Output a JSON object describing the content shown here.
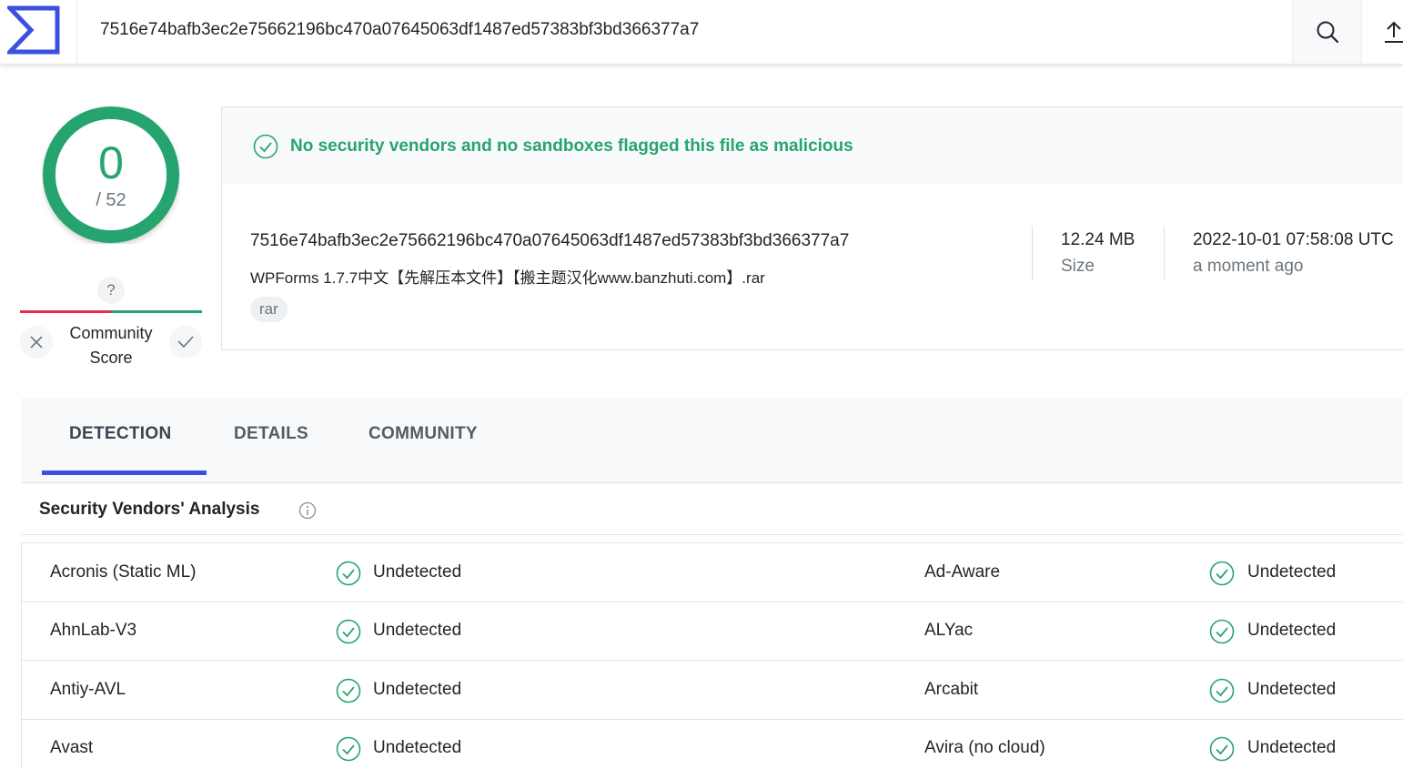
{
  "header": {
    "search_value": "7516e74bafb3ec2e75662196bc470a07645063df1487ed57383bf3bd366377a7",
    "logo_icon": "virustotal-sigma-logo-icon",
    "search_icon": "search-icon",
    "upload_icon": "upload-icon"
  },
  "score": {
    "detections": "0",
    "total": "/ 52",
    "ring_color": "#27a46f"
  },
  "community": {
    "question": "?",
    "label_line1": "Community",
    "label_line2": "Score"
  },
  "summary": {
    "message": "No security vendors and no sandboxes flagged this file as malicious",
    "hash": "7516e74bafb3ec2e75662196bc470a07645063df1487ed57383bf3bd366377a7",
    "filename": "WPForms 1.7.7中文【先解压本文件】【搬主题汉化www.banzhuti.com】.rar",
    "tag": "rar",
    "size_value": "12.24 MB",
    "size_label": "Size",
    "date_value": "2022-10-01 07:58:08 UTC",
    "date_label": "a moment ago",
    "accent_color": "#27a46f"
  },
  "tabs": [
    {
      "label": "DETECTION",
      "active": true
    },
    {
      "label": "DETAILS",
      "active": false
    },
    {
      "label": "COMMUNITY",
      "active": false
    }
  ],
  "vendors": {
    "title": "Security Vendors' Analysis",
    "rows": [
      {
        "left": {
          "name": "Acronis (Static ML)",
          "status": "Undetected"
        },
        "right": {
          "name": "Ad-Aware",
          "status": "Undetected"
        }
      },
      {
        "left": {
          "name": "AhnLab-V3",
          "status": "Undetected"
        },
        "right": {
          "name": "ALYac",
          "status": "Undetected"
        }
      },
      {
        "left": {
          "name": "Antiy-AVL",
          "status": "Undetected"
        },
        "right": {
          "name": "Arcabit",
          "status": "Undetected"
        }
      },
      {
        "left": {
          "name": "Avast",
          "status": "Undetected"
        },
        "right": {
          "name": "Avira (no cloud)",
          "status": "Undetected"
        }
      }
    ]
  }
}
